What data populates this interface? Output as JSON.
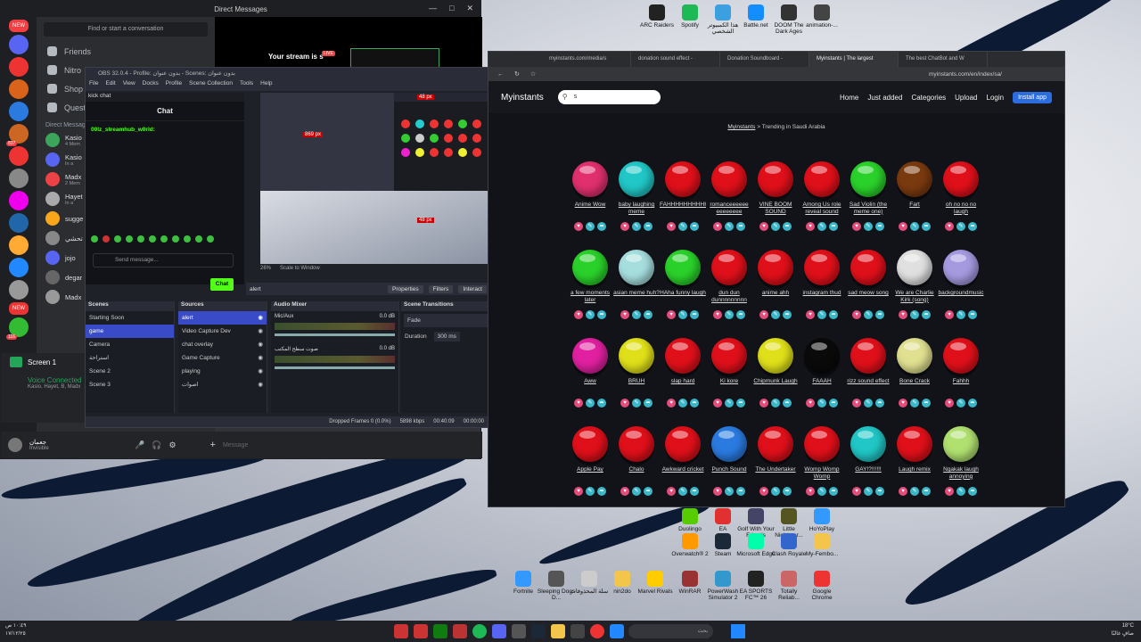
{
  "discord": {
    "title": "Direct Messages",
    "find": "Find or start a conversation",
    "nav": [
      "Friends",
      "Nitro",
      "Shop",
      "Quests"
    ],
    "dm_header": "Direct Messages",
    "dms": [
      {
        "name": "Kasio",
        "sub": "4 Mem"
      },
      {
        "name": "Kasio",
        "sub": "In a"
      },
      {
        "name": "Madx",
        "sub": "2 Mem"
      },
      {
        "name": "Hayet",
        "sub": "In a"
      },
      {
        "name": "sugge",
        "sub": ""
      },
      {
        "name": "تحشي",
        "sub": ""
      },
      {
        "name": "jojo",
        "sub": ""
      },
      {
        "name": "degar",
        "sub": ""
      },
      {
        "name": "Madx",
        "sub": ""
      }
    ],
    "stream_text": "Your stream is s",
    "live": "LIVE",
    "screen_label": "Screen 1",
    "voice_connected": "Voice Connected",
    "voice_users": "Kasio, Hayet, B, Madx",
    "username": "جعمان",
    "user_status": "Invisible",
    "message_placeholder": "Message",
    "badges": [
      "NEW",
      "837",
      "NEW",
      "116"
    ]
  },
  "obs": {
    "title": "OBS 32.0.4 - Profile: بدون عنوان - Scenes: بدون عنوان",
    "menu": [
      "File",
      "Edit",
      "View",
      "Docks",
      "Profile",
      "Scene Collection",
      "Tools",
      "Help"
    ],
    "kick_title": "kick chat",
    "chat_header": "Chat",
    "chat_user": "00lz_streamhub_w0rld:",
    "send_placeholder": "Send message...",
    "chat_button": "Chat",
    "preview_measure_1": "869 px",
    "preview_measure_2": "48 px",
    "preview_measure_3": "48 px",
    "zoom": "26%",
    "scale_to_window": "Scale to Window",
    "source_selected": "alert",
    "btn_properties": "Properties",
    "btn_filters": "Filters",
    "btn_interact": "Interact",
    "scenes_title": "Scenes",
    "scenes": [
      "Starting Soon",
      "game",
      "Camera",
      "استراحة",
      "Scene 2",
      "Scene 3"
    ],
    "selected_scene_index": 1,
    "sources_title": "Sources",
    "sources": [
      "alert",
      "Video Capture Dev",
      "chat overlay",
      "Game Capture",
      "playing",
      "اصوات"
    ],
    "mixer_title": "Audio Mixer",
    "mixer_channels": [
      {
        "name": "Mic/Aux",
        "db": "0.0 dB"
      },
      {
        "name": "صوت سطح المكتب",
        "db": "0.0 dB"
      }
    ],
    "transitions_title": "Scene Transitions",
    "transition": "Fade",
    "duration_label": "Duration",
    "duration": "300 ms",
    "dropped_frames": "Dropped Frames 0 (0.0%)",
    "bitrate": "5898 kbps",
    "stream_time": "00:40:09",
    "rec_time": "00:00:00"
  },
  "browser": {
    "tabs": [
      "myinstants.com/media/s",
      "donation sound effect -",
      "Donation Soundboard -",
      "Myinstants | The largest",
      "The best ChatBot and W"
    ],
    "active_tab_index": 3,
    "url": "myinstants.com/en/index/sa/",
    "site_name": "Myinstants",
    "search_value": "s",
    "menu": [
      "Home",
      "Just added",
      "Categories",
      "Upload",
      "Login"
    ],
    "install": "Install app",
    "breadcrumb_link": "Myinstants",
    "breadcrumb_rest": "> Trending in Saudi Arabia",
    "sounds": [
      {
        "name": "Anime Wow",
        "color": "#e0306e"
      },
      {
        "name": "baby laughing meme",
        "color": "#21c6c6"
      },
      {
        "name": "FAHHHHHHHHHHHHHHH",
        "color": "#e0101a"
      },
      {
        "name": "romanceeeeee eeeeeeee",
        "color": "#e0101a"
      },
      {
        "name": "VINE BOOM SOUND",
        "color": "#e0101a"
      },
      {
        "name": "Among Us role reveal sound",
        "color": "#e0101a"
      },
      {
        "name": "Sad Violin (the meme one)",
        "color": "#2ad12a"
      },
      {
        "name": "Fart",
        "color": "#7a3a10"
      },
      {
        "name": "oh no no no laugh",
        "color": "#e0101a"
      },
      {
        "name": "a few moments later",
        "color": "#2ad12a"
      },
      {
        "name": "asian meme huh?",
        "color": "#a6dede"
      },
      {
        "name": "HAha funny laugh",
        "color": "#2ad12a"
      },
      {
        "name": "dun dun dunnnnnnnnn",
        "color": "#e0101a"
      },
      {
        "name": "anime ahh",
        "color": "#e0101a"
      },
      {
        "name": "instagram thud",
        "color": "#e0101a"
      },
      {
        "name": "sad meow song",
        "color": "#e0101a"
      },
      {
        "name": "We are Charlie Kirk (song)",
        "color": "#e0e0e0"
      },
      {
        "name": "backgroundmusic",
        "color": "#a59ae0"
      },
      {
        "name": "Aww",
        "color": "#e020a0"
      },
      {
        "name": "BRUH",
        "color": "#e0e01a"
      },
      {
        "name": "slap hard",
        "color": "#e0101a"
      },
      {
        "name": "Ki kore",
        "color": "#e0101a"
      },
      {
        "name": "Chipmunk Laugh",
        "color": "#e0e01a"
      },
      {
        "name": "FAAAH",
        "color": "#0a0a0a"
      },
      {
        "name": "rizz sound effect",
        "color": "#e0101a"
      },
      {
        "name": "Bone Crack",
        "color": "#e0e090"
      },
      {
        "name": "Fahhh",
        "color": "#e0101a"
      },
      {
        "name": "Apple Pay",
        "color": "#e0101a"
      },
      {
        "name": "Chalo",
        "color": "#e0101a"
      },
      {
        "name": "Awkward cricket",
        "color": "#e0101a"
      },
      {
        "name": "Punch Sound",
        "color": "#2a7ae0"
      },
      {
        "name": "The Undertaker",
        "color": "#e0101a"
      },
      {
        "name": "Womp Womp Womp",
        "color": "#e0101a"
      },
      {
        "name": "GAY!?!!!!!!",
        "color": "#21c6c6"
      },
      {
        "name": "Laugh remix",
        "color": "#e0101a"
      },
      {
        "name": "Ngakak laugh annoying",
        "color": "#b0e070"
      }
    ]
  },
  "desktop_icons": [
    {
      "label": "ARC Raiders",
      "color": "#222"
    },
    {
      "label": "Spotify",
      "color": "#1db954"
    },
    {
      "label": "هذا الكمبيوتر الشخصي",
      "color": "#3aa0e0"
    },
    {
      "label": "Battle.net",
      "color": "#148eff"
    },
    {
      "label": "DOOM The Dark Ages",
      "color": "#333"
    },
    {
      "label": "animation-...",
      "color": "#444"
    },
    {
      "label": "Duolingo",
      "color": "#58cc02"
    },
    {
      "label": "EA",
      "color": "#e03030"
    },
    {
      "label": "Golf With Your Friends",
      "color": "#446"
    },
    {
      "label": "Little Nightmar...",
      "color": "#552"
    },
    {
      "label": "HoYoPlay",
      "color": "#39f"
    },
    {
      "label": "Overwatch® 2",
      "color": "#f90"
    },
    {
      "label": "Steam",
      "color": "#1b2838"
    },
    {
      "label": "Microsoft Edge",
      "color": "#0fa"
    },
    {
      "label": "Clash Royale",
      "color": "#36c"
    },
    {
      "label": "My-Fembo...",
      "color": "#f3c64b"
    },
    {
      "label": "Fortnite",
      "color": "#39f"
    },
    {
      "label": "Sleeping Dogs D...",
      "color": "#555"
    },
    {
      "label": "سلة المحذوفات",
      "color": "#ccc"
    },
    {
      "label": "nin2do",
      "color": "#f3c64b"
    },
    {
      "label": "Marvel Rivals",
      "color": "#fc0"
    },
    {
      "label": "WinRAR",
      "color": "#933"
    },
    {
      "label": "PowerWash Simulator 2",
      "color": "#39c"
    },
    {
      "label": "EA SPORTS FC™ 26",
      "color": "#222"
    },
    {
      "label": "Totally Reliab...",
      "color": "#c66"
    },
    {
      "label": "Google Chrome",
      "color": "#e33"
    }
  ],
  "taskbar": {
    "search": "بحث",
    "time": "١٠:٤٩ ص",
    "date": "١٧/١٢/٢٥",
    "temp": "18°C",
    "weather": "صافٍ غالبًا"
  }
}
